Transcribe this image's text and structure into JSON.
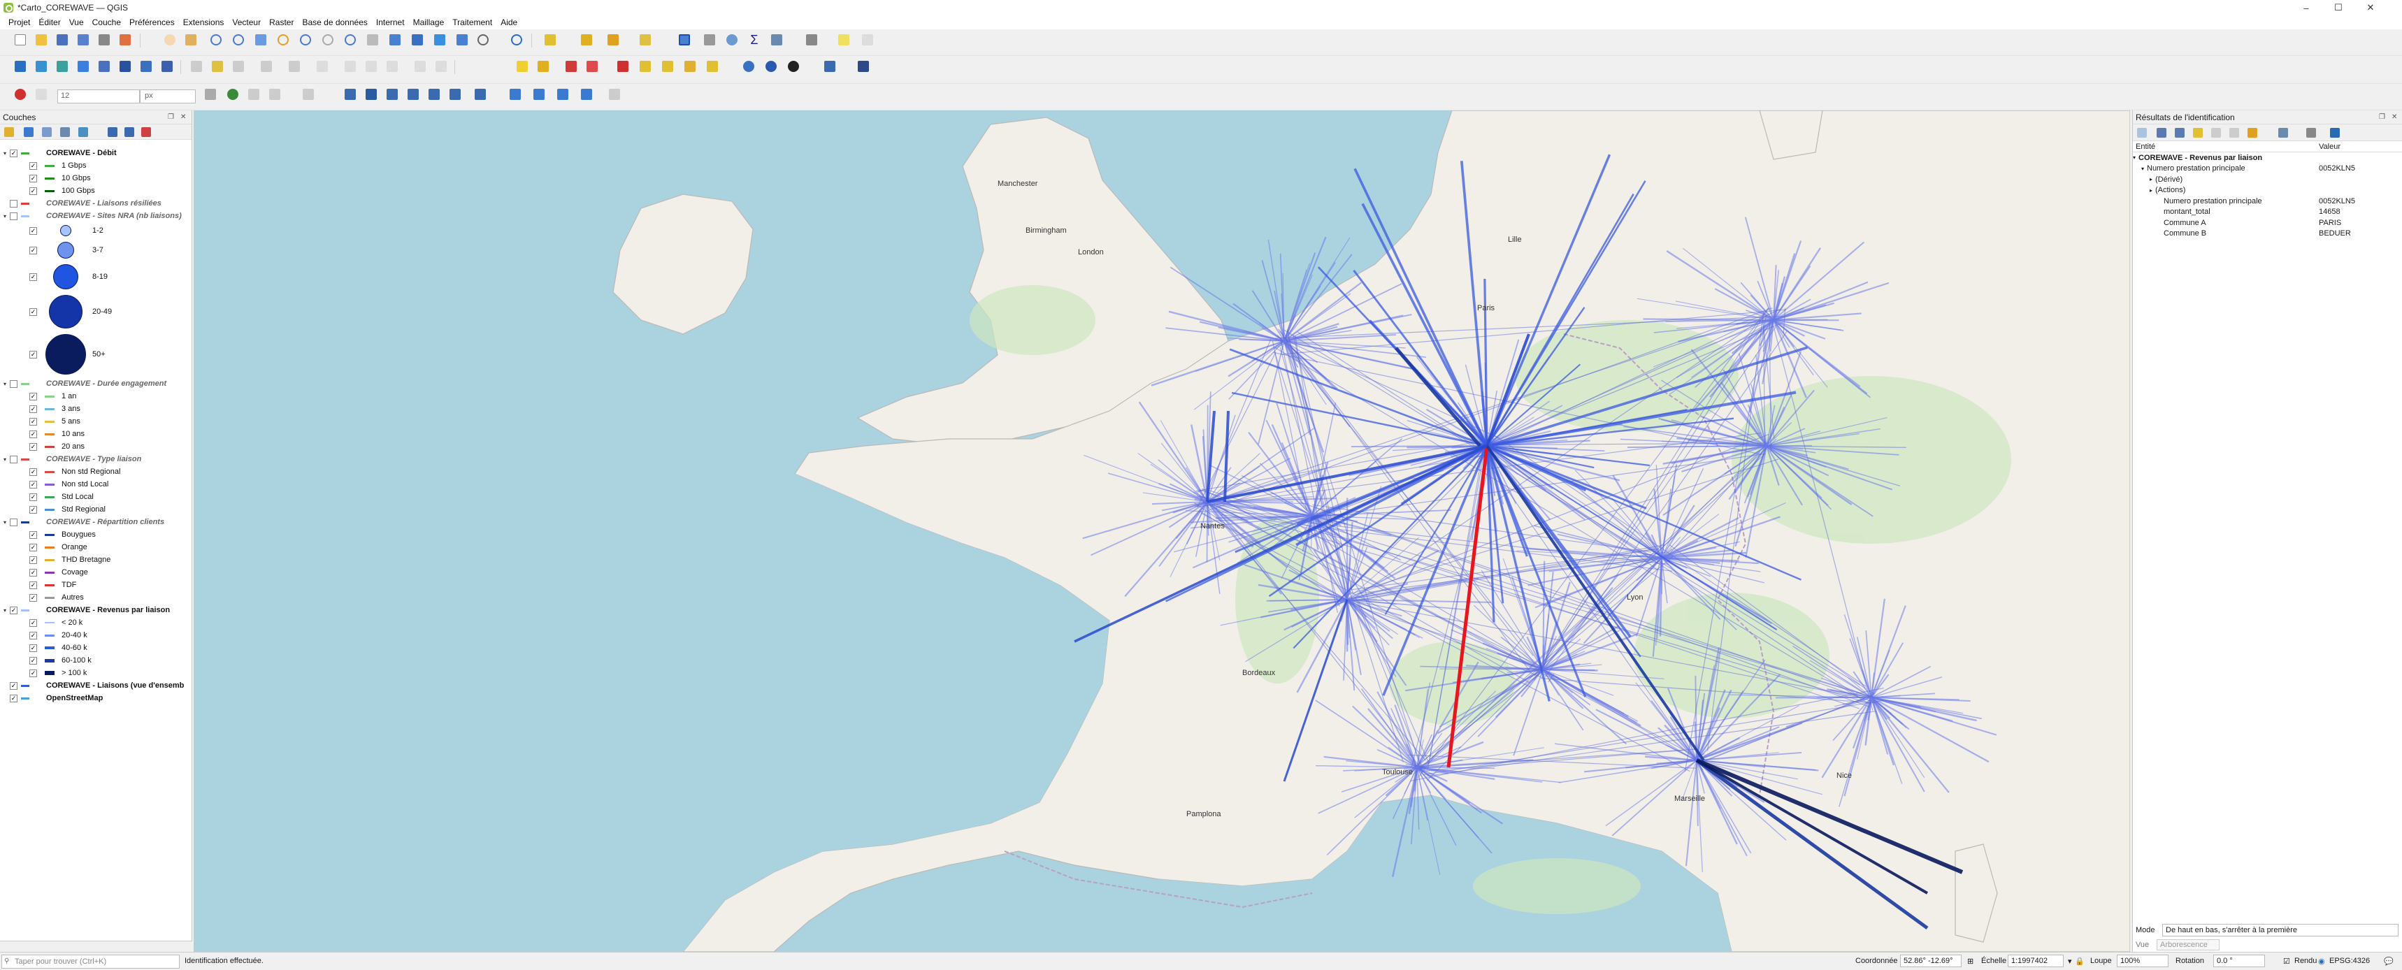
{
  "window": {
    "title": "*Carto_COREWAVE — QGIS",
    "minimize": "–",
    "maximize": "☐",
    "close": "✕"
  },
  "menu": [
    "Projet",
    "Éditer",
    "Vue",
    "Couche",
    "Préférences",
    "Extensions",
    "Vecteur",
    "Raster",
    "Base de données",
    "Internet",
    "Maillage",
    "Traitement",
    "Aide"
  ],
  "toolbar": {
    "font_size_value": "12",
    "font_unit": "px"
  },
  "layers_panel": {
    "title": "Couches",
    "groups": [
      {
        "name": "COREWAVE - Débit",
        "italic": false,
        "items": [
          "1 Gbps",
          "10 Gbps",
          "100 Gbps"
        ],
        "colors": [
          "#3fae3f",
          "#1e8f1e",
          "#0a5e0a"
        ]
      },
      {
        "name": "COREWAVE - Liaisons résiliées",
        "italic": true,
        "items": [],
        "colors": [
          "#e23b3b"
        ]
      },
      {
        "name": "COREWAVE - Sites NRA (nb liaisons)",
        "italic": true,
        "items": [
          "1-2",
          "3-7",
          "8-19",
          "20-49",
          "50+"
        ],
        "colors": [
          "#a8c3ff",
          "#6e93ee",
          "#1f55e0",
          "#1435a8",
          "#0a1c5e"
        ]
      },
      {
        "name": "COREWAVE - Durée engagement",
        "italic": true,
        "items": [
          "1 an",
          "3 ans",
          "5 ans",
          "10 ans",
          "20 ans"
        ],
        "colors": [
          "#8ad08a",
          "#6cb8d8",
          "#e0c040",
          "#e08a30",
          "#d84040"
        ]
      },
      {
        "name": "COREWAVE - Type liaison",
        "italic": true,
        "items": [
          "Non std Regional",
          "Non std Local",
          "Std Local",
          "Std Regional"
        ],
        "colors": [
          "#d84a4a",
          "#8a5ad0",
          "#3aaa5a",
          "#4a90d0"
        ]
      },
      {
        "name": "COREWAVE - Répartition clients",
        "italic": true,
        "items": [
          "Bouygues",
          "Orange",
          "THD Bretagne",
          "Covage",
          "TDF",
          "Autres"
        ],
        "colors": [
          "#1a3a9a",
          "#f07820",
          "#e0b030",
          "#8a3ab0",
          "#e03030",
          "#999999"
        ]
      },
      {
        "name": "COREWAVE - Revenus par liaison",
        "italic": false,
        "items": [
          "< 20 k",
          "20-40 k",
          "40-60 k",
          "60-100 k",
          "> 100 k"
        ],
        "colors": [
          "#a8c0ff",
          "#6a8df0",
          "#2a5ae0",
          "#1a3aa0",
          "#0a1a5e"
        ]
      },
      {
        "name": "COREWAVE - Liaisons (vue d'ensemb",
        "italic": false,
        "items": [],
        "colors": [
          "#3a5ad0"
        ]
      },
      {
        "name": "OpenStreetMap",
        "italic": false,
        "items": [],
        "colors": [
          "#4aa0e0"
        ]
      }
    ]
  },
  "results_panel": {
    "title": "Résultats de l'identification",
    "col_entity": "Entité",
    "col_value": "Valeur",
    "rows": [
      {
        "k": "COREWAVE - Revenus par liaison",
        "v": "",
        "level": 0,
        "bold": true
      },
      {
        "k": "Numero prestation principale",
        "v": "0052KLN5",
        "level": 1,
        "bold": false
      },
      {
        "k": "(Dérivé)",
        "v": "",
        "level": 2,
        "bold": false
      },
      {
        "k": "(Actions)",
        "v": "",
        "level": 2,
        "bold": false
      },
      {
        "k": "Numero prestation principale",
        "v": "0052KLN5",
        "level": 3,
        "bold": false
      },
      {
        "k": "montant_total",
        "v": "14658",
        "level": 3,
        "bold": false
      },
      {
        "k": "Commune A",
        "v": "PARIS",
        "level": 3,
        "bold": false
      },
      {
        "k": "Commune B",
        "v": "BEDUER",
        "level": 3,
        "bold": false
      }
    ],
    "mode_label": "Mode",
    "mode_value": "De haut en bas, s'arrêter à la première",
    "view_label": "Vue",
    "view_value": "Arborescence"
  },
  "map_labels": {
    "paris": "Paris",
    "london": "London",
    "bordeaux": "Bordeaux",
    "lyon": "Lyon",
    "marseille": "Marseille",
    "pamplona": "Pamplona",
    "manchester": "Manchester",
    "birmingham": "Birmingham",
    "lille": "Lille",
    "nantes": "Nantes",
    "toulouse": "Toulouse",
    "nice": "Nice"
  },
  "status": {
    "search_placeholder": "Taper pour trouver (Ctrl+K)",
    "message": "Identification effectuée.",
    "coord_label": "Coordonnée",
    "coord_value": "52.86° -12.69°",
    "scale_label": "Échelle",
    "scale_value": "1:1997402",
    "magnifier_label": "Loupe",
    "magnifier_value": "100%",
    "rotation_label": "Rotation",
    "rotation_value": "0.0 °",
    "render_label": "Rendu",
    "crs": "EPSG:4326"
  }
}
